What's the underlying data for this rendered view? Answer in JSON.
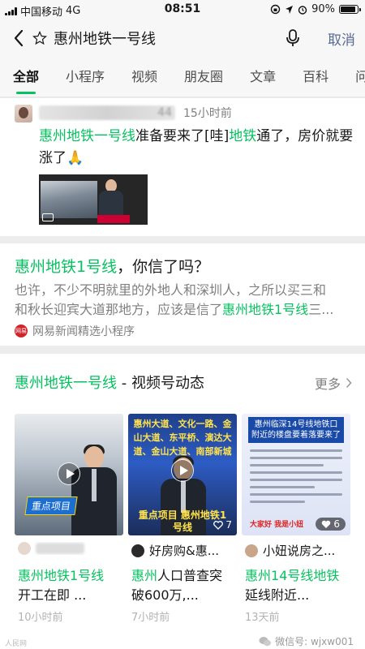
{
  "status_bar": {
    "carrier": "中国移动",
    "network": "4G",
    "time": "08:51",
    "battery_percent": "90%",
    "battery_level": 0.9
  },
  "search": {
    "query": "惠州地铁一号线",
    "cancel_label": "取消"
  },
  "tabs": [
    {
      "label": "全部",
      "active": true
    },
    {
      "label": "小程序",
      "active": false
    },
    {
      "label": "视频",
      "active": false
    },
    {
      "label": "朋友圈",
      "active": false
    },
    {
      "label": "文章",
      "active": false
    },
    {
      "label": "百科",
      "active": false
    },
    {
      "label": "问",
      "active": false
    }
  ],
  "moment": {
    "name_suffix": "44",
    "time": "15小时前",
    "text_highlight_1": "惠州地铁一号线",
    "text_part_1": "准备要来了[哇]",
    "text_highlight_2": "地铁",
    "text_part_2": "通了，房价就要涨了",
    "emoji": "🙏"
  },
  "article": {
    "title_highlight": "惠州地铁1号线",
    "title_rest": "，你信了吗？",
    "snippet_line1": "也许，不少不明就里的外地人和深圳人，之所以买三和",
    "snippet_line2_plain": "和秋长迎宾大道那地方，应该是信了",
    "snippet_line2_highlight": "惠州地铁1号线",
    "snippet_line2_tail": "三...",
    "source_icon_text": "网易",
    "source_name": "网易新闻精选小程序"
  },
  "channels": {
    "title_highlight": "惠州地铁一号线",
    "title_rest": " - 视频号动态",
    "more_label": "更多",
    "videos": [
      {
        "banner": "重点项目",
        "author": "",
        "title_highlight": "惠州地铁1号线",
        "title_rest": "开工在即 ...",
        "time": "10小时前",
        "likes": ""
      },
      {
        "overlay": "惠州大道、文化一路、金山大道、东平桥、演达大道、金山大道、南部新城",
        "banner": "重点项目 惠州地铁1号线",
        "author": "好房购&惠...",
        "title_highlight": "惠州",
        "title_rest": "人口普查突破600万,...",
        "time": "7小时前",
        "likes": "7"
      },
      {
        "overlay": "惠州临深14号线地铁口附近的楼盘要着落要来了",
        "banner": "大家好 我是小妞",
        "author": "小妞说房之...",
        "title_highlight_1": "惠州",
        "title_mid": "14号线地铁",
        "title_rest": "延线附近...",
        "time": "13天前",
        "likes": "6"
      }
    ]
  },
  "watermark": {
    "text": "微信号: wjxw001",
    "left_text": "人民网"
  }
}
